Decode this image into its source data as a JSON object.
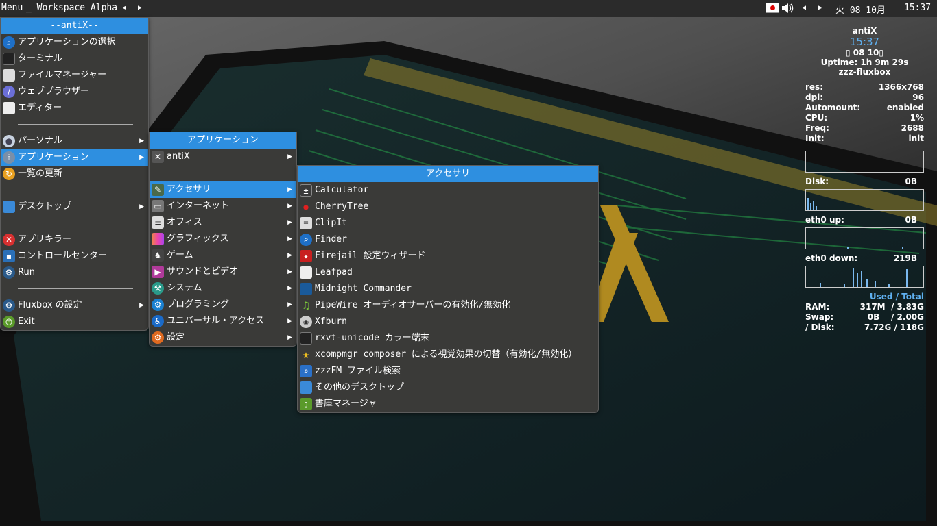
{
  "topbar": {
    "menu": "Menu",
    "workspace": "_ Workspace Alpha",
    "prev": "◀",
    "next": "▶",
    "tray_prev": "◀",
    "tray_next": "▶",
    "date": "火 08 10月",
    "time": "15:37",
    "volume_icon": "volume-icon",
    "flag_icon": "japan-flag-icon"
  },
  "main_menu": {
    "title": "--antiX--",
    "items": [
      {
        "label": "アプリケーションの選択",
        "icon": "search-icon"
      },
      {
        "label": "ターミナル",
        "icon": "terminal-icon"
      },
      {
        "label": "ファイルマネージャー",
        "icon": "file-manager-icon"
      },
      {
        "label": "ウェブブラウザー",
        "icon": "web-browser-icon"
      },
      {
        "label": "エディター",
        "icon": "editor-icon"
      },
      {
        "label": "パーソナル",
        "icon": "user-icon"
      },
      {
        "label": "アプリケーション",
        "icon": "applications-icon"
      },
      {
        "label": "一覧の更新",
        "icon": "refresh-icon"
      },
      {
        "label": "デスクトップ",
        "icon": "desktop-icon"
      },
      {
        "label": "アプリキラー",
        "icon": "kill-icon"
      },
      {
        "label": "コントロールセンター",
        "icon": "control-center-icon"
      },
      {
        "label": "Run",
        "icon": "run-icon"
      },
      {
        "label": "Fluxbox の設定",
        "icon": "fluxbox-settings-icon"
      },
      {
        "label": "Exit",
        "icon": "exit-icon"
      }
    ]
  },
  "apps_menu": {
    "title": "アプリケーション",
    "items": [
      {
        "label": "antiX",
        "icon": "antix-icon"
      },
      {
        "label": "アクセサリ",
        "icon": "accessories-icon"
      },
      {
        "label": "インターネット",
        "icon": "internet-icon"
      },
      {
        "label": "オフィス",
        "icon": "office-icon"
      },
      {
        "label": "グラフィックス",
        "icon": "graphics-icon"
      },
      {
        "label": "ゲーム",
        "icon": "games-icon"
      },
      {
        "label": "サウンドとビデオ",
        "icon": "multimedia-icon"
      },
      {
        "label": "システム",
        "icon": "system-icon"
      },
      {
        "label": "プログラミング",
        "icon": "programming-icon"
      },
      {
        "label": "ユニバーサル・アクセス",
        "icon": "accessibility-icon"
      },
      {
        "label": "設定",
        "icon": "settings-icon"
      }
    ]
  },
  "acc_menu": {
    "title": "アクセサリ",
    "items": [
      {
        "label": "Calculator",
        "icon": "calculator-icon"
      },
      {
        "label": "CherryTree",
        "icon": "cherrytree-icon"
      },
      {
        "label": "ClipIt",
        "icon": "clipboard-icon"
      },
      {
        "label": "Finder",
        "icon": "finder-icon"
      },
      {
        "label": "Firejail 設定ウィザード",
        "icon": "firejail-icon"
      },
      {
        "label": "Leafpad",
        "icon": "leafpad-icon"
      },
      {
        "label": "Midnight Commander",
        "icon": "midnight-commander-icon"
      },
      {
        "label": "PipeWire オーディオサーバーの有効化/無効化",
        "icon": "music-note-icon"
      },
      {
        "label": "Xfburn",
        "icon": "disc-icon"
      },
      {
        "label": "rxvt-unicode カラー端末",
        "icon": "terminal-icon"
      },
      {
        "label": "xcompmgr composer による視覚効果の切替（有効化/無効化）",
        "icon": "star-icon"
      },
      {
        "label": "zzzFM ファイル検索",
        "icon": "file-search-icon"
      },
      {
        "label": "その他のデスクトップ",
        "icon": "desktop-icon"
      },
      {
        "label": "書庫マネージャ",
        "icon": "archive-icon"
      }
    ]
  },
  "conky": {
    "host": "antiX",
    "time": "15:37",
    "date": "▯ 08 10▯",
    "uptime": "Uptime: 1h 9m 29s",
    "session": "zzz-fluxbox",
    "res_label": "res:",
    "res": "1366x768",
    "dpi_label": "dpi:",
    "dpi": "96",
    "automount_label": "Automount:",
    "automount": "enabled",
    "cpu_label": "CPU:",
    "cpu": "1%",
    "freq_label": "Freq:",
    "freq": "2688",
    "init_label": "Init:",
    "init": "init",
    "disk_label": "Disk:",
    "disk": "0B",
    "up_label": "eth0 up:",
    "up": "0B",
    "down_label": "eth0 down:",
    "down": "219B",
    "used_total": "Used  / Total",
    "ram_label": "RAM:",
    "ram": "317M  / 3.83G",
    "swap_label": "Swap:",
    "swap": "0B    / 2.00G",
    "rdisk_label": "/ Disk:",
    "rdisk": "7.72G / 118G",
    "accent": "#5fb0f0"
  },
  "colors": {
    "selection": "#2e8fe0",
    "menu_bg": "#3a3a38",
    "topbar_bg": "#2b2b2b"
  }
}
